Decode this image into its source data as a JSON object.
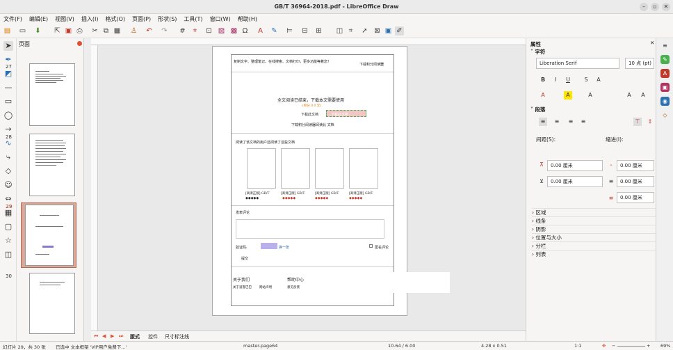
{
  "window": {
    "title": "GB/T 36964-2018.pdf - LibreOffice Draw"
  },
  "menu": [
    "文件(F)",
    "编辑(E)",
    "视图(V)",
    "插入(I)",
    "格式(O)",
    "页面(P)",
    "形状(S)",
    "工具(T)",
    "窗口(W)",
    "帮助(H)"
  ],
  "pages_panel": {
    "title": "页面",
    "pages": [
      "27",
      "28",
      "29",
      "30"
    ]
  },
  "doc": {
    "header_left": "复制文字、整理笔记、在线搜索、文档打印，更多功能等着您！",
    "header_right": "下载积分阅读器",
    "end_notice": "全文阅读已结束，下载本文需要使用",
    "price": "(积分 0.0 元)",
    "download_label": "下载此文档",
    "download_btn": "下载此文档",
    "download_alt": "下载积分阅读器阅读此 文档",
    "related_title": "阅读了该文档的用户还阅读了这些文档",
    "related": [
      {
        "tag": "[高清正版] GB/T",
        "score": "◆◆◆◆◆"
      },
      {
        "tag": "[高清正版] GB/T",
        "score": "◆◆◆◆◆"
      },
      {
        "tag": "[高清正版] GB/T",
        "score": "◆◆◆◆◆"
      },
      {
        "tag": "[高清正版] GB/T",
        "score": "◆◆◆◆◆"
      }
    ],
    "comment_title": "发表评论",
    "verify_label": "验证码:",
    "change_label": "换一张",
    "anon_label": "匿名评论",
    "submit": "提交",
    "footer_about": "关于我们",
    "footer_help": "帮助中心",
    "footer_link1": "关于道客巴巴",
    "footer_link2": "网站声明",
    "footer_link3": "意见反馈"
  },
  "tabs": {
    "layout": "版式",
    "controls": "控件",
    "dimension": "尺寸标注线"
  },
  "status": {
    "slide": "幻灯片 29，共 30 张",
    "selection": "已选中 文本框架 'VIP用户免费下...'",
    "master": "master-page64",
    "position": "10.64 / 6.00",
    "size": "4.28 x 0.51",
    "scale": "1:1",
    "zoom": "69%"
  },
  "sidebar": {
    "title": "属性",
    "char_section": "字符",
    "font_name": "Liberation Serif",
    "font_size": "10 点 (pt)",
    "para_section": "段落",
    "spacing_label": "间距(S):",
    "indent_label": "缩进(I):",
    "spacing_above": "0.00 厘米",
    "spacing_below": "0.00 厘米",
    "indent_before": "0.00 厘米",
    "indent_after": "0.00 厘米",
    "indent_first": "0.00 厘米",
    "sections": [
      "区域",
      "线条",
      "阴影",
      "位置与大小",
      "分栏",
      "列表"
    ]
  }
}
